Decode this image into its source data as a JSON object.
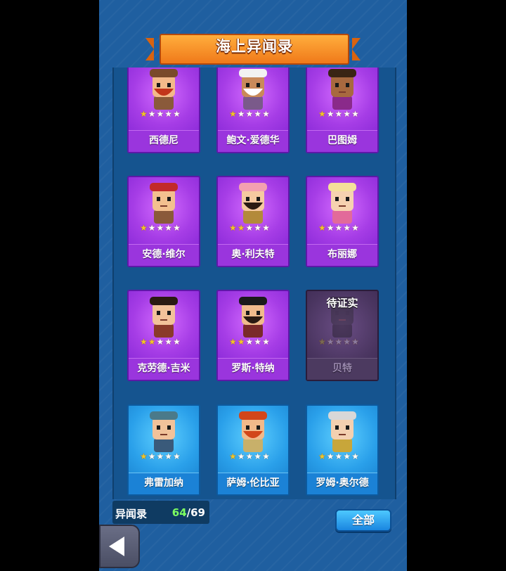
{
  "header": {
    "title": "海上异闻录"
  },
  "cards": [
    {
      "name": "西德尼",
      "stars": 1,
      "theme": "purple",
      "locked": false
    },
    {
      "name": "鲍文·爱德华",
      "stars": 1,
      "theme": "purple",
      "locked": false
    },
    {
      "name": "巴图姆",
      "stars": 1,
      "theme": "purple",
      "locked": false
    },
    {
      "name": "安德·维尔",
      "stars": 1,
      "theme": "purple",
      "locked": false
    },
    {
      "name": "奥·利夫特",
      "stars": 2,
      "theme": "purple",
      "locked": false
    },
    {
      "name": "布丽娜",
      "stars": 1,
      "theme": "purple",
      "locked": false
    },
    {
      "name": "克劳德·吉米",
      "stars": 2,
      "theme": "purple",
      "locked": false
    },
    {
      "name": "罗斯·特纳",
      "stars": 2,
      "theme": "purple",
      "locked": false
    },
    {
      "name": "贝特",
      "stars": 1,
      "theme": "gray",
      "locked": true,
      "overlay": "待证实"
    },
    {
      "name": "弗雷加纳",
      "stars": 1,
      "theme": "blue",
      "locked": false
    },
    {
      "name": "萨姆·伦比亚",
      "stars": 1,
      "theme": "blue",
      "locked": false
    },
    {
      "name": "罗姆·奥尔德",
      "stars": 1,
      "theme": "blue",
      "locked": false
    }
  ],
  "star_max": 5,
  "footer": {
    "counter_label": "异闻录",
    "collected": "64",
    "separator": "/",
    "total": "69",
    "all_button": "全部"
  },
  "icons": {
    "back": "back-arrow-icon",
    "star": "star-icon"
  },
  "colors": {
    "background": "#1f5fa0",
    "banner": "#f0791a",
    "purple_card": "#a63de6",
    "blue_card": "#2aa0ea",
    "count_green": "#7dff61"
  }
}
